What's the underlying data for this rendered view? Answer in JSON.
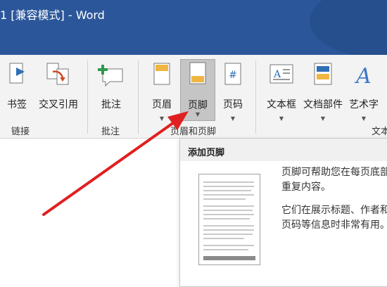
{
  "window": {
    "title": "1 [兼容模式]  -  Word"
  },
  "ribbon": {
    "buttons": {
      "bookmark": "书签",
      "cross_reference": "交叉引用",
      "comment": "批注",
      "header": "页眉",
      "footer": "页脚",
      "page_number": "页码",
      "text_box": "文本框",
      "doc_parts": "文档部件",
      "word_art": "艺术字"
    },
    "groups": {
      "links": "链接",
      "comments": "批注",
      "header_footer": "页眉和页脚",
      "text": "文本"
    }
  },
  "footer_menu": {
    "title": "添加页脚",
    "desc1": "页脚可帮助您在每页底部重复内容。",
    "desc2": "它们在展示标题、作者和页码等信息时非常有用。"
  },
  "colors": {
    "title_bar": "#2b579a",
    "arrow": "#e02020",
    "ribbon_bg": "#f3f3f3"
  }
}
